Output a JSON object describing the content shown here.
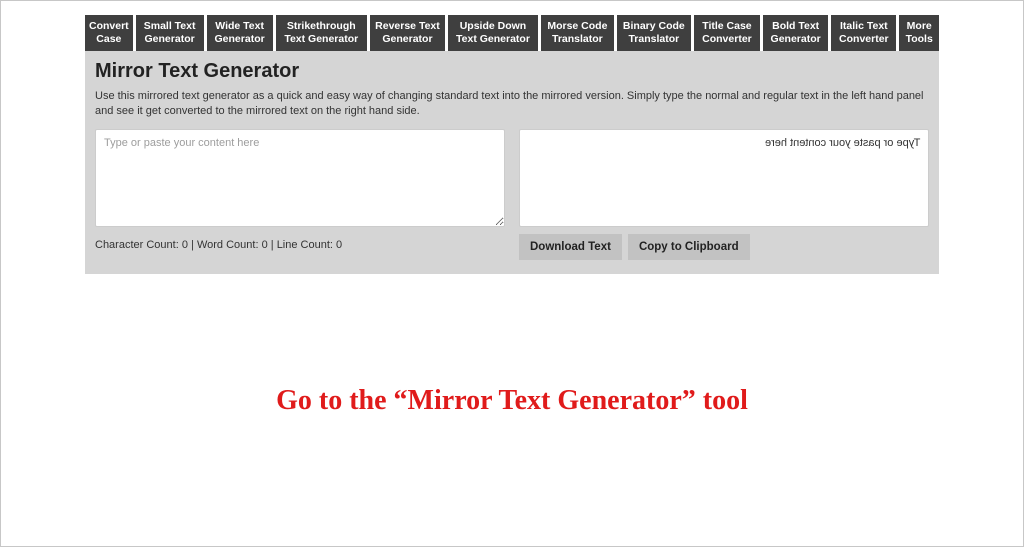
{
  "nav": {
    "items": [
      "Convert Case",
      "Small Text Generator",
      "Wide Text Generator",
      "Strikethrough Text Generator",
      "Reverse Text Generator",
      "Upside Down Text Generator",
      "Morse Code Translator",
      "Binary Code Translator",
      "Title Case Converter",
      "Bold Text Generator",
      "Italic Text Converter",
      "More Tools"
    ]
  },
  "heading": "Mirror Text Generator",
  "description": "Use this mirrored text generator as a quick and easy way of changing standard text into the mirrored version. Simply type the normal and regular text in the left hand panel and see it get converted to the mirrored text on the right hand side.",
  "input": {
    "placeholder": "Type or paste your content here",
    "value": ""
  },
  "output": {
    "text": "Type or paste your content here"
  },
  "buttons": {
    "download": "Download Text",
    "copy": "Copy to Clipboard"
  },
  "stats": {
    "char_label": "Character Count",
    "word_label": "Word Count",
    "line_label": "Line Count",
    "char": 0,
    "word": 0,
    "line": 0
  },
  "annotation": "Go to the “Mirror Text Generator” tool"
}
